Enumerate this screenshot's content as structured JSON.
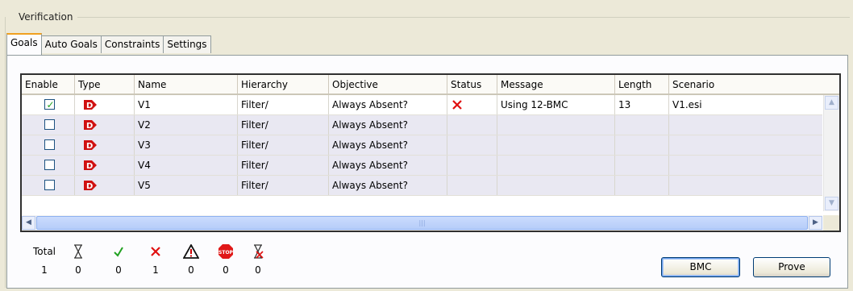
{
  "group_title": "Verification",
  "tabs": [
    {
      "label": "Goals",
      "active": true
    },
    {
      "label": "Auto Goals",
      "active": false
    },
    {
      "label": "Constraints",
      "active": false
    },
    {
      "label": "Settings",
      "active": false
    }
  ],
  "table": {
    "columns": [
      "Enable",
      "Type",
      "Name",
      "Hierarchy",
      "Objective",
      "Status",
      "Message",
      "Length",
      "Scenario"
    ],
    "rows": [
      {
        "enabled": true,
        "type_icon": "assertion-d-icon",
        "name": "V1",
        "hierarchy": "Filter/",
        "objective": "Always Absent?",
        "status_icon": "failed-x-icon",
        "message": "Using 12-BMC",
        "length": "13",
        "scenario": "V1.esi"
      },
      {
        "enabled": false,
        "type_icon": "assertion-d-icon",
        "name": "V2",
        "hierarchy": "Filter/",
        "objective": "Always Absent?",
        "status_icon": "",
        "message": "",
        "length": "",
        "scenario": ""
      },
      {
        "enabled": false,
        "type_icon": "assertion-d-icon",
        "name": "V3",
        "hierarchy": "Filter/",
        "objective": "Always Absent?",
        "status_icon": "",
        "message": "",
        "length": "",
        "scenario": ""
      },
      {
        "enabled": false,
        "type_icon": "assertion-d-icon",
        "name": "V4",
        "hierarchy": "Filter/",
        "objective": "Always Absent?",
        "status_icon": "",
        "message": "",
        "length": "",
        "scenario": ""
      },
      {
        "enabled": false,
        "type_icon": "assertion-d-icon",
        "name": "V5",
        "hierarchy": "Filter/",
        "objective": "Always Absent?",
        "status_icon": "",
        "message": "",
        "length": "",
        "scenario": ""
      }
    ]
  },
  "summary": {
    "total_label": "Total",
    "total": "1",
    "pending": "0",
    "passed": "0",
    "failed": "1",
    "warning": "0",
    "stopped": "0",
    "cancelled": "0"
  },
  "buttons": {
    "bmc": "BMC",
    "prove": "Prove"
  },
  "colors": {
    "accent_tab": "#f0a020",
    "fail": "#e01010",
    "pass": "#21a121",
    "type_icon": "#d01010",
    "stripe": "#e9e8f2"
  }
}
